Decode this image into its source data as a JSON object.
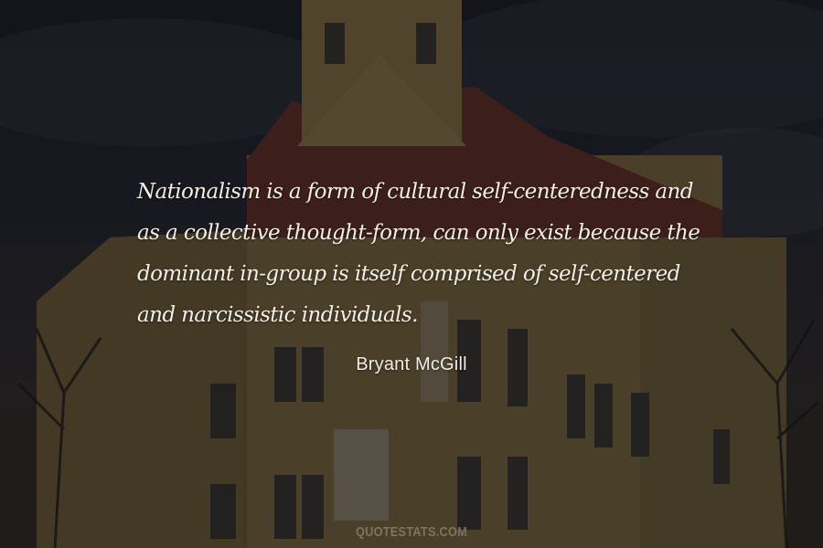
{
  "quote": {
    "text": "Nationalism is a form of cultural self-centeredness and as a collective thought-form, can only exist because the dominant in-group is itself comprised of self-centered and narcissistic individuals."
  },
  "author": {
    "name": "Bryant McGill"
  },
  "watermark": {
    "text": "QUOTESTATS.COM"
  },
  "background": {
    "subject": "historic yellow building with tower under a cloudy sky",
    "overlay_color": "#0a0a0e",
    "text_color": "#f3efe6"
  }
}
